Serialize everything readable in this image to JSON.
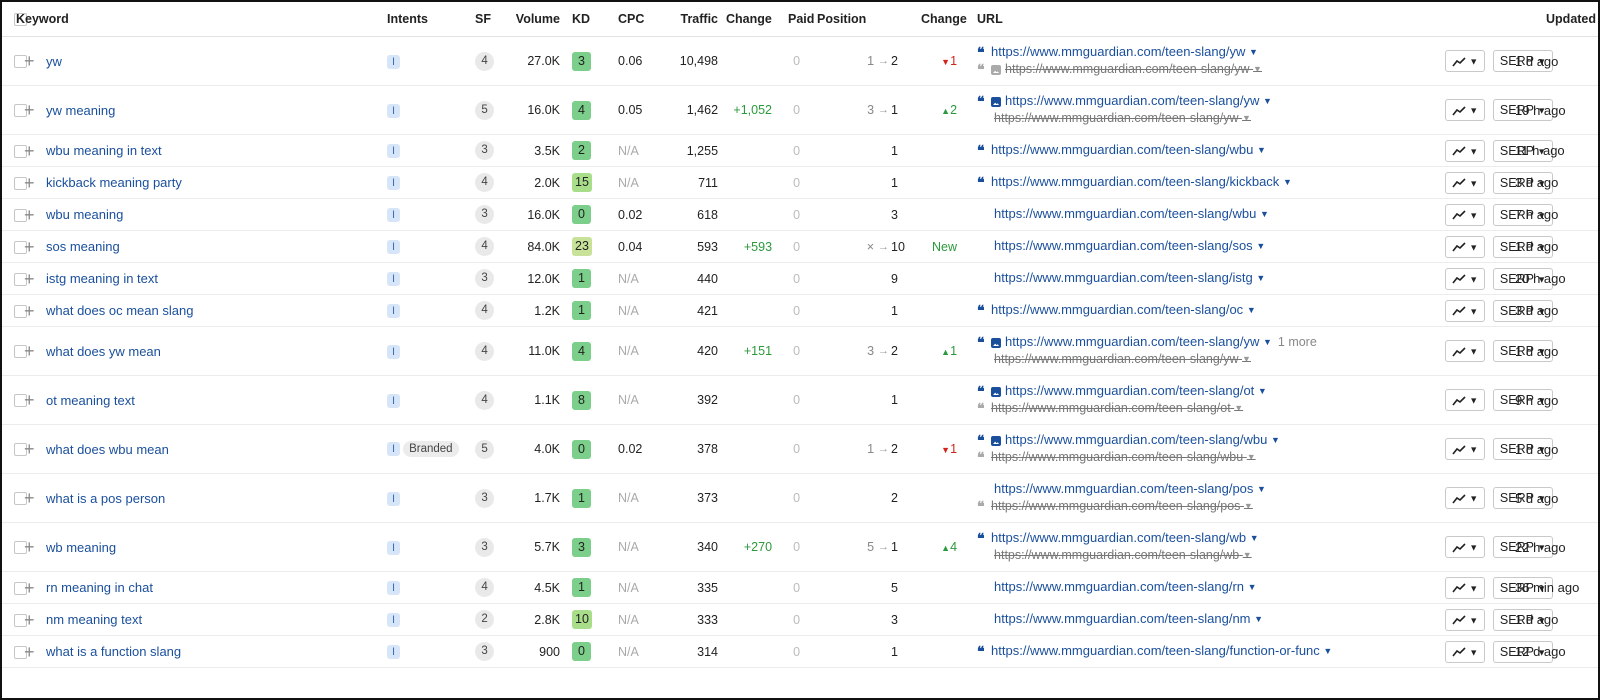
{
  "header": {
    "keyword": "Keyword",
    "intents": "Intents",
    "sf": "SF",
    "volume": "Volume",
    "kd": "KD",
    "cpc": "CPC",
    "traffic": "Traffic",
    "change": "Change",
    "paid": "Paid",
    "position": "Position",
    "position_change": "Change",
    "url": "URL",
    "updated": "Updated"
  },
  "actions": {
    "serp_label": "SERP"
  },
  "colors": {
    "link": "#1a4f9c",
    "positive": "#2b9a3c",
    "negative": "#d0241c",
    "kd_green": "#7ccf8a",
    "kd_light": "#a8dd8a",
    "kd_yellow": "#c9e29a"
  },
  "rows": [
    {
      "keyword": "yw",
      "intent": "I",
      "branded": "",
      "sf": "4",
      "volume": "27.0K",
      "kd": "3",
      "kd_color": "#7ccf8a",
      "cpc": "0.06",
      "traffic": "10,498",
      "change": "",
      "paid": "0",
      "pos_from": "1",
      "pos_to": "2",
      "pos_change": "1",
      "pos_dir": "down",
      "url": "https://www.mmguardian.com/teen-slang/yw",
      "url_icons": "quote",
      "url2": "https://www.mmguardian.com/teen-slang/yw",
      "url2_icons": "quote-img",
      "more": "",
      "updated": "1 d ago"
    },
    {
      "keyword": "yw meaning",
      "intent": "I",
      "branded": "",
      "sf": "5",
      "volume": "16.0K",
      "kd": "4",
      "kd_color": "#7ccf8a",
      "cpc": "0.05",
      "traffic": "1,462",
      "change": "+1,052",
      "paid": "0",
      "pos_from": "3",
      "pos_to": "1",
      "pos_change": "2",
      "pos_dir": "up",
      "url": "https://www.mmguardian.com/teen-slang/yw",
      "url_icons": "quote-img",
      "url2": "https://www.mmguardian.com/teen-slang/yw",
      "url2_icons": "none",
      "more": "",
      "updated": "19 h ago"
    },
    {
      "keyword": "wbu meaning in text",
      "intent": "I",
      "branded": "",
      "sf": "3",
      "volume": "3.5K",
      "kd": "2",
      "kd_color": "#7ccf8a",
      "cpc": "N/A",
      "traffic": "1,255",
      "change": "",
      "paid": "0",
      "pos_from": "",
      "pos_to": "1",
      "pos_change": "",
      "pos_dir": "",
      "url": "https://www.mmguardian.com/teen-slang/wbu",
      "url_icons": "quote",
      "url2": "",
      "url2_icons": "",
      "more": "",
      "updated": "11 h ago"
    },
    {
      "keyword": "kickback meaning party",
      "intent": "I",
      "branded": "",
      "sf": "4",
      "volume": "2.0K",
      "kd": "15",
      "kd_color": "#a8dd8a",
      "cpc": "N/A",
      "traffic": "711",
      "change": "",
      "paid": "0",
      "pos_from": "",
      "pos_to": "1",
      "pos_change": "",
      "pos_dir": "",
      "url": "https://www.mmguardian.com/teen-slang/kickback",
      "url_icons": "quote",
      "url2": "",
      "url2_icons": "",
      "more": "",
      "updated": "3 d ago"
    },
    {
      "keyword": "wbu meaning",
      "intent": "I",
      "branded": "",
      "sf": "3",
      "volume": "16.0K",
      "kd": "0",
      "kd_color": "#7ccf8a",
      "cpc": "0.02",
      "traffic": "618",
      "change": "",
      "paid": "0",
      "pos_from": "",
      "pos_to": "3",
      "pos_change": "",
      "pos_dir": "",
      "url": "https://www.mmguardian.com/teen-slang/wbu",
      "url_icons": "none",
      "url2": "",
      "url2_icons": "",
      "more": "",
      "updated": "7 h ago"
    },
    {
      "keyword": "sos meaning",
      "intent": "I",
      "branded": "",
      "sf": "4",
      "volume": "84.0K",
      "kd": "23",
      "kd_color": "#c9e29a",
      "cpc": "0.04",
      "traffic": "593",
      "change": "+593",
      "paid": "0",
      "pos_from": "×",
      "pos_to": "10",
      "pos_change": "New",
      "pos_dir": "new",
      "url": "https://www.mmguardian.com/teen-slang/sos",
      "url_icons": "none",
      "url2": "",
      "url2_icons": "",
      "more": "",
      "updated": "1 d ago"
    },
    {
      "keyword": "istg meaning in text",
      "intent": "I",
      "branded": "",
      "sf": "3",
      "volume": "12.0K",
      "kd": "1",
      "kd_color": "#7ccf8a",
      "cpc": "N/A",
      "traffic": "440",
      "change": "",
      "paid": "0",
      "pos_from": "",
      "pos_to": "9",
      "pos_change": "",
      "pos_dir": "",
      "url": "https://www.mmguardian.com/teen-slang/istg",
      "url_icons": "none",
      "url2": "",
      "url2_icons": "",
      "more": "",
      "updated": "20 h ago"
    },
    {
      "keyword": "what does oc mean slang",
      "intent": "I",
      "branded": "",
      "sf": "4",
      "volume": "1.2K",
      "kd": "1",
      "kd_color": "#7ccf8a",
      "cpc": "N/A",
      "traffic": "421",
      "change": "",
      "paid": "0",
      "pos_from": "",
      "pos_to": "1",
      "pos_change": "",
      "pos_dir": "",
      "url": "https://www.mmguardian.com/teen-slang/oc",
      "url_icons": "quote",
      "url2": "",
      "url2_icons": "",
      "more": "",
      "updated": "3 d ago"
    },
    {
      "keyword": "what does yw mean",
      "intent": "I",
      "branded": "",
      "sf": "4",
      "volume": "11.0K",
      "kd": "4",
      "kd_color": "#7ccf8a",
      "cpc": "N/A",
      "traffic": "420",
      "change": "+151",
      "paid": "0",
      "pos_from": "3",
      "pos_to": "2",
      "pos_change": "1",
      "pos_dir": "up",
      "url": "https://www.mmguardian.com/teen-slang/yw",
      "url_icons": "quote-img",
      "url2": "https://www.mmguardian.com/teen-slang/yw",
      "url2_icons": "none",
      "more": "1 more",
      "updated": "1 d ago"
    },
    {
      "keyword": "ot meaning text",
      "intent": "I",
      "branded": "",
      "sf": "4",
      "volume": "1.1K",
      "kd": "8",
      "kd_color": "#7ccf8a",
      "cpc": "N/A",
      "traffic": "392",
      "change": "",
      "paid": "0",
      "pos_from": "",
      "pos_to": "1",
      "pos_change": "",
      "pos_dir": "",
      "url": "https://www.mmguardian.com/teen-slang/ot",
      "url_icons": "quote-img",
      "url2": "https://www.mmguardian.com/teen-slang/ot",
      "url2_icons": "quote",
      "more": "",
      "updated": "9 h ago"
    },
    {
      "keyword": "what does wbu mean",
      "intent": "I",
      "branded": "Branded",
      "sf": "5",
      "volume": "4.0K",
      "kd": "0",
      "kd_color": "#7ccf8a",
      "cpc": "0.02",
      "traffic": "378",
      "change": "",
      "paid": "0",
      "pos_from": "1",
      "pos_to": "2",
      "pos_change": "1",
      "pos_dir": "down",
      "url": "https://www.mmguardian.com/teen-slang/wbu",
      "url_icons": "quote-img",
      "url2": "https://www.mmguardian.com/teen-slang/wbu",
      "url2_icons": "quote",
      "more": "",
      "updated": "1 d ago"
    },
    {
      "keyword": "what is a pos person",
      "intent": "I",
      "branded": "",
      "sf": "3",
      "volume": "1.7K",
      "kd": "1",
      "kd_color": "#7ccf8a",
      "cpc": "N/A",
      "traffic": "373",
      "change": "",
      "paid": "0",
      "pos_from": "",
      "pos_to": "2",
      "pos_change": "",
      "pos_dir": "",
      "url": "https://www.mmguardian.com/teen-slang/pos",
      "url_icons": "none",
      "url2": "https://www.mmguardian.com/teen-slang/pos",
      "url2_icons": "quote",
      "more": "",
      "updated": "5 d ago"
    },
    {
      "keyword": "wb meaning",
      "intent": "I",
      "branded": "",
      "sf": "3",
      "volume": "5.7K",
      "kd": "3",
      "kd_color": "#7ccf8a",
      "cpc": "N/A",
      "traffic": "340",
      "change": "+270",
      "paid": "0",
      "pos_from": "5",
      "pos_to": "1",
      "pos_change": "4",
      "pos_dir": "up",
      "url": "https://www.mmguardian.com/teen-slang/wb",
      "url_icons": "quote",
      "url2": "https://www.mmguardian.com/teen-slang/wb",
      "url2_icons": "none",
      "more": "",
      "updated": "22 h ago"
    },
    {
      "keyword": "rn meaning in chat",
      "intent": "I",
      "branded": "",
      "sf": "4",
      "volume": "4.5K",
      "kd": "1",
      "kd_color": "#7ccf8a",
      "cpc": "N/A",
      "traffic": "335",
      "change": "",
      "paid": "0",
      "pos_from": "",
      "pos_to": "5",
      "pos_change": "",
      "pos_dir": "",
      "url": "https://www.mmguardian.com/teen-slang/rn",
      "url_icons": "none",
      "url2": "",
      "url2_icons": "",
      "more": "",
      "updated": "36 min ago"
    },
    {
      "keyword": "nm meaning text",
      "intent": "I",
      "branded": "",
      "sf": "2",
      "volume": "2.8K",
      "kd": "10",
      "kd_color": "#a8dd8a",
      "cpc": "N/A",
      "traffic": "333",
      "change": "",
      "paid": "0",
      "pos_from": "",
      "pos_to": "3",
      "pos_change": "",
      "pos_dir": "",
      "url": "https://www.mmguardian.com/teen-slang/nm",
      "url_icons": "none",
      "url2": "",
      "url2_icons": "",
      "more": "",
      "updated": "1 d ago"
    },
    {
      "keyword": "what is a function slang",
      "intent": "I",
      "branded": "",
      "sf": "3",
      "volume": "900",
      "kd": "0",
      "kd_color": "#7ccf8a",
      "cpc": "N/A",
      "traffic": "314",
      "change": "",
      "paid": "0",
      "pos_from": "",
      "pos_to": "1",
      "pos_change": "",
      "pos_dir": "",
      "url": "https://www.mmguardian.com/teen-slang/function-or-func",
      "url_icons": "quote",
      "url2": "",
      "url2_icons": "",
      "more": "",
      "updated": "12 d ago"
    }
  ]
}
